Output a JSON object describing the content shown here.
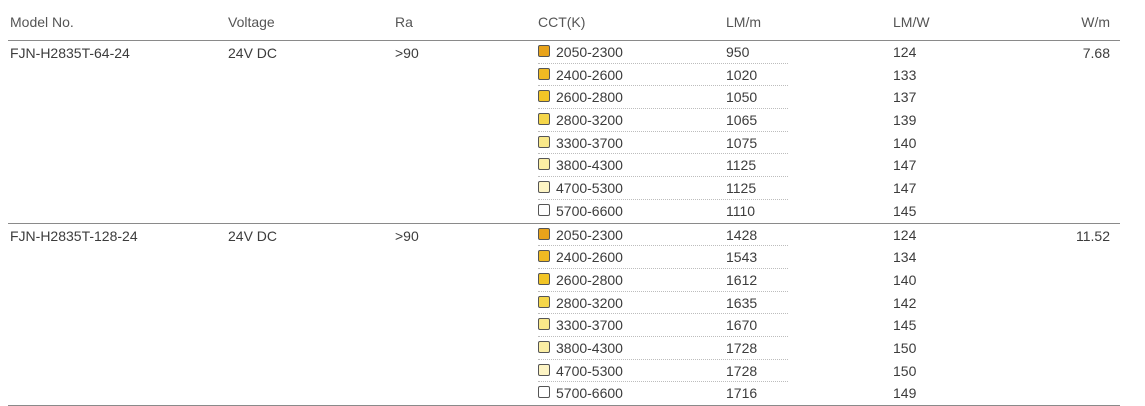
{
  "headers": {
    "model": "Model No.",
    "voltage": "Voltage",
    "ra": "Ra",
    "cct": "CCT(K)",
    "lm_m": "LM/m",
    "lm_w": "LM/W",
    "w_m": "W/m"
  },
  "models": [
    {
      "model": "FJN-H2835T-64-24",
      "voltage": "24V DC",
      "ra": ">90",
      "w_m": "7.68",
      "rows": [
        {
          "cct": "2050-2300",
          "lm_m": "950",
          "lm_w": "124",
          "color": "#e8a31a"
        },
        {
          "cct": "2400-2600",
          "lm_m": "1020",
          "lm_w": "133",
          "color": "#efba22"
        },
        {
          "cct": "2600-2800",
          "lm_m": "1050",
          "lm_w": "137",
          "color": "#f2c526"
        },
        {
          "cct": "2800-3200",
          "lm_m": "1065",
          "lm_w": "139",
          "color": "#f5d64a"
        },
        {
          "cct": "3300-3700",
          "lm_m": "1075",
          "lm_w": "140",
          "color": "#f9e88a"
        },
        {
          "cct": "3800-4300",
          "lm_m": "1125",
          "lm_w": "147",
          "color": "#fbeea4"
        },
        {
          "cct": "4700-5300",
          "lm_m": "1125",
          "lm_w": "147",
          "color": "#fdf4c4"
        },
        {
          "cct": "5700-6600",
          "lm_m": "1110",
          "lm_w": "145",
          "color": "#ffffff"
        }
      ]
    },
    {
      "model": "FJN-H2835T-128-24",
      "voltage": "24V DC",
      "ra": ">90",
      "w_m": "11.52",
      "rows": [
        {
          "cct": "2050-2300",
          "lm_m": "1428",
          "lm_w": "124",
          "color": "#e8a31a"
        },
        {
          "cct": "2400-2600",
          "lm_m": "1543",
          "lm_w": "134",
          "color": "#efba22"
        },
        {
          "cct": "2600-2800",
          "lm_m": "1612",
          "lm_w": "140",
          "color": "#f2c526"
        },
        {
          "cct": "2800-3200",
          "lm_m": "1635",
          "lm_w": "142",
          "color": "#f5d64a"
        },
        {
          "cct": "3300-3700",
          "lm_m": "1670",
          "lm_w": "145",
          "color": "#f9e88a"
        },
        {
          "cct": "3800-4300",
          "lm_m": "1728",
          "lm_w": "150",
          "color": "#fbeea4"
        },
        {
          "cct": "4700-5300",
          "lm_m": "1728",
          "lm_w": "150",
          "color": "#fdf4c4"
        },
        {
          "cct": "5700-6600",
          "lm_m": "1716",
          "lm_w": "149",
          "color": "#ffffff"
        }
      ]
    }
  ]
}
